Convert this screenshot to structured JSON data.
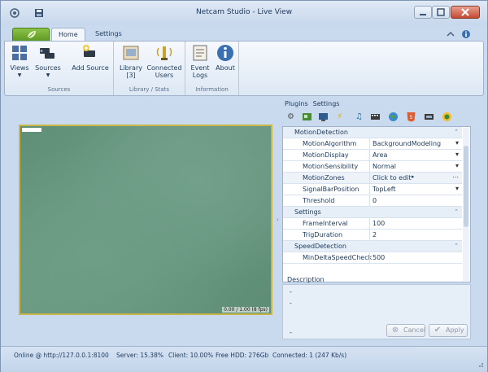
{
  "window": {
    "title": "Netcam Studio - Live View"
  },
  "ribbon": {
    "tabs": [
      {
        "label": "Home",
        "active": true
      },
      {
        "label": "Settings",
        "active": false
      }
    ],
    "groups": [
      {
        "label": "Sources",
        "buttons": [
          {
            "label": "Views",
            "icon": "grid-views-icon"
          },
          {
            "label": "Sources",
            "icon": "cameras-icon"
          },
          {
            "label": "Add Source",
            "icon": "add-camera-icon"
          }
        ]
      },
      {
        "label": "Library / Stats",
        "buttons": [
          {
            "label": "Library",
            "sub": "[3]",
            "icon": "library-icon"
          },
          {
            "label": "Connected",
            "sub": "Users",
            "icon": "connected-users-icon"
          }
        ]
      },
      {
        "label": "Information",
        "buttons": [
          {
            "label": "Event",
            "sub": "Logs",
            "icon": "event-logs-icon"
          },
          {
            "label": "About",
            "icon": "info-icon"
          }
        ]
      }
    ]
  },
  "video": {
    "status": "0.00 / 1.00 (8 fps)"
  },
  "panel": {
    "tabs": [
      "Plugins",
      "Settings"
    ],
    "categories": [
      {
        "label": "MotionDetection",
        "rows": [
          {
            "name": "MotionAlgorithm",
            "value": "BackgroundModeling",
            "dropdown": true
          },
          {
            "name": "MotionDisplay",
            "value": "Area",
            "dropdown": true
          },
          {
            "name": "MotionSensibility",
            "value": "Normal",
            "dropdown": true
          },
          {
            "name": "MotionZones",
            "value": "Click to edit",
            "ellipsis": true
          },
          {
            "name": "SignalBarPosition",
            "value": "TopLeft",
            "dropdown": true
          },
          {
            "name": "Threshold",
            "value": "0"
          }
        ]
      },
      {
        "label": "Settings",
        "rows": [
          {
            "name": "FrameInterval",
            "value": "100"
          },
          {
            "name": "TrigDuration",
            "value": "2"
          }
        ]
      },
      {
        "label": "SpeedDetection",
        "rows": [
          {
            "name": "MinDeltaSpeedCheck",
            "value": "500"
          }
        ]
      }
    ],
    "description_label": "Description",
    "description_lines": [
      "-",
      "-",
      "-"
    ],
    "cancel_label": "Cancel",
    "apply_label": "Apply"
  },
  "status": {
    "online": "Online @ http://127.0.0.1:8100",
    "server": "Server: 15.38%",
    "client": "Client: 10.00%",
    "hdd": "Free HDD: 276Gb",
    "connected": "Connected: 1 (247 Kb/s)"
  }
}
